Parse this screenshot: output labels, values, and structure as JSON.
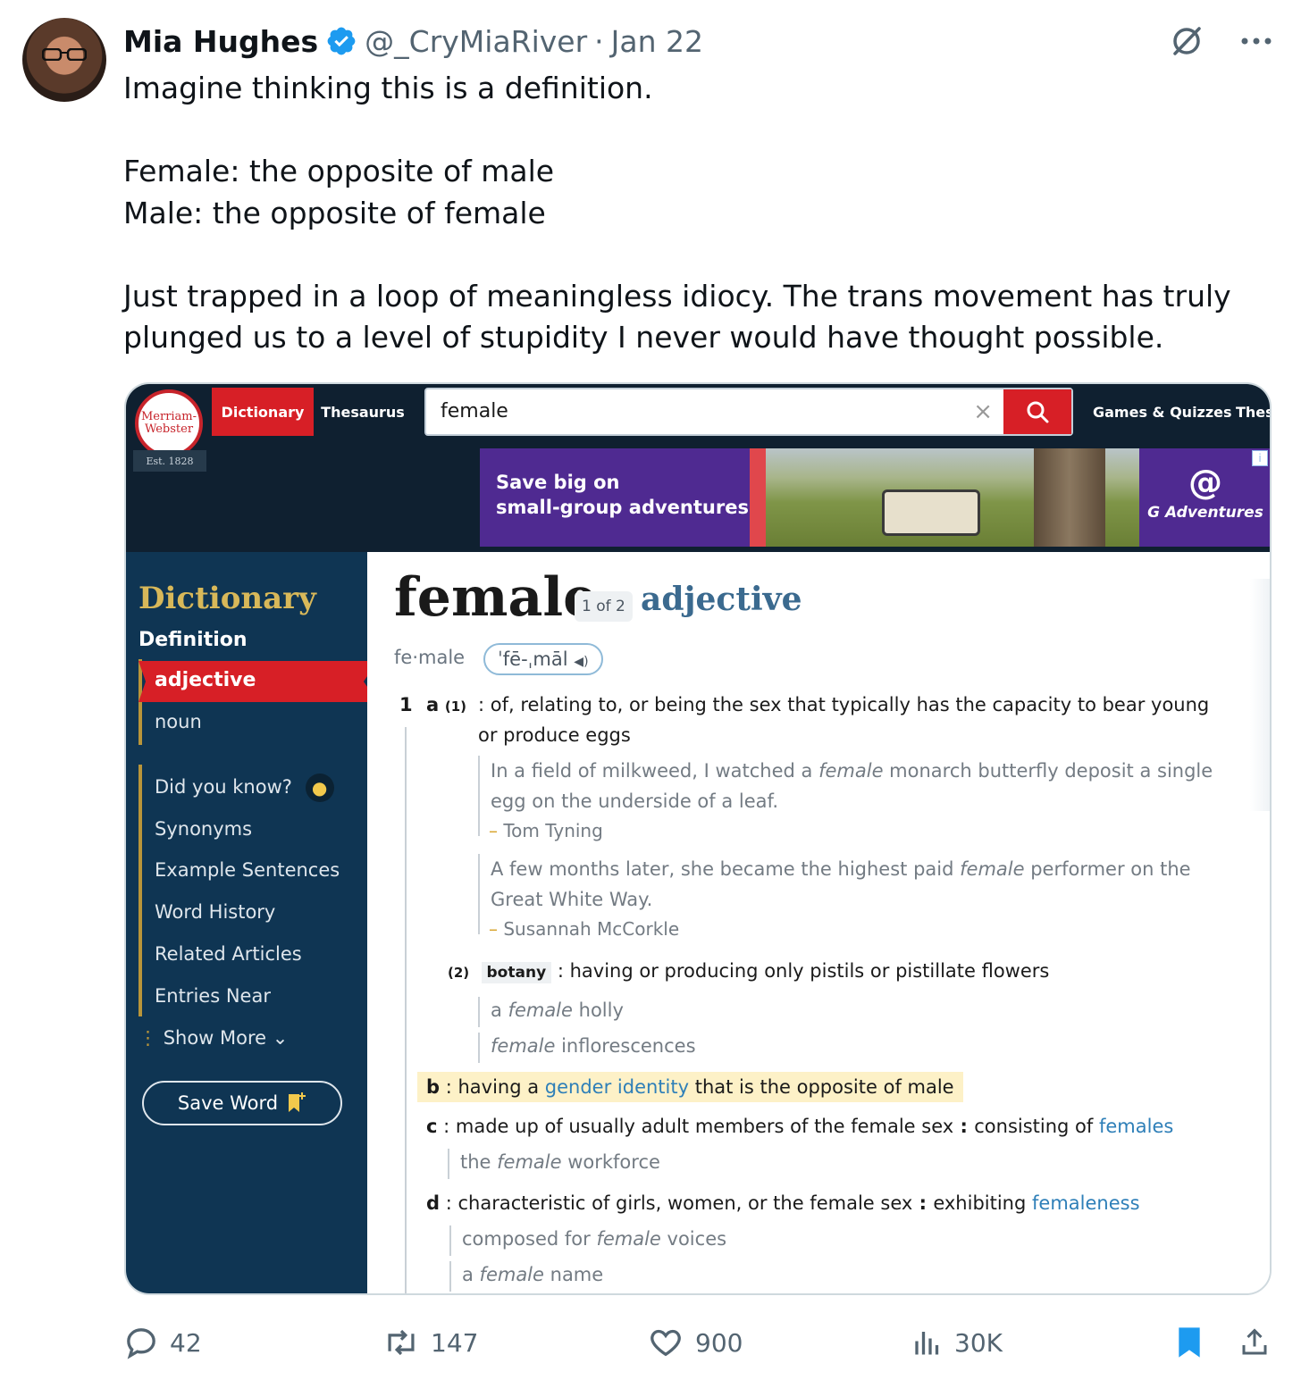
{
  "tweet": {
    "display_name": "Mia Hughes",
    "handle": "@_CryMiaRiver",
    "separator": "·",
    "date": "Jan 22",
    "text": [
      "Imagine thinking this is a definition.",
      "",
      "Female: the opposite of male",
      "Male: the opposite of female",
      "",
      "Just trapped in a loop of meaningless idiocy. The trans movement has truly plunged us to a level of stupidity I never would have thought possible."
    ]
  },
  "site": {
    "logo_line1": "Merriam-",
    "logo_line2": "Webster",
    "est": "Est. 1828",
    "nav_dictionary": "Dictionary",
    "nav_thesaurus": "Thesaurus",
    "search_value": "female",
    "search_clear": "×",
    "nav_games": "Games & Quizzes",
    "nav_thes_cut": "Thes"
  },
  "ad": {
    "line1": "Save big on",
    "line2": "small-group adventures!",
    "brand": "G Adventures",
    "info": "i"
  },
  "sidebar": {
    "title": "Dictionary",
    "subtitle": "Definition",
    "active": "adjective",
    "items": [
      "noun",
      "Did you know?",
      "Synonyms",
      "Example Sentences",
      "Word History",
      "Related Articles",
      "Entries Near",
      "Show More"
    ],
    "save": "Save Word"
  },
  "entry": {
    "headword": "female",
    "count": "1 of 2",
    "pos": "adjective",
    "syllables": "fe·male",
    "pron": "ˈfē-ˌmāl",
    "sense1_num": "1",
    "a": "a",
    "a1": "(1)",
    "a1_text_l1": ": of, relating to, or being the sex that typically has the capacity to bear young",
    "a1_text_l2": "or produce eggs",
    "ex1_pre": "In a field of milkweed, I watched a ",
    "ex1_it": "female",
    "ex1_post": " monarch butterfly deposit a single",
    "ex1_l2": "egg on the underside of a leaf.",
    "ex1_author": "Tom Tyning",
    "ex2_pre": "A few months later, she became the highest paid ",
    "ex2_it": "female",
    "ex2_post": " performer on the",
    "ex2_l2": "Great White Way.",
    "ex2_author": "Susannah McCorkle",
    "a2": "(2)",
    "botany": "botany",
    "a2_text": ": having or producing only pistils or pistillate flowers",
    "ex3_pre": "a ",
    "ex3_it": "female",
    "ex3_post": " holly",
    "ex4_it": "female",
    "ex4_post": " inflorescences",
    "b": "b",
    "b_pre": ": having a ",
    "b_link": "gender identity",
    "b_post": " that is the opposite of male",
    "c": "c",
    "c_text": ": made up of usually adult members of the female sex",
    "c_sep": " : ",
    "c_text2": "consisting of ",
    "c_link": "females",
    "ex5_pre": "the ",
    "ex5_it": "female",
    "ex5_post": " workforce",
    "d": "d",
    "d_text": ": characteristic of girls, women, or the female sex",
    "d_sep": " : ",
    "d_text2": "exhibiting ",
    "d_link": "femaleness",
    "ex6_pre": "composed for ",
    "ex6_it": "female",
    "ex6_post": " voices",
    "ex7_pre": "a ",
    "ex7_it": "female",
    "ex7_post": " name"
  },
  "actions": {
    "replies": "42",
    "reposts": "147",
    "likes": "900",
    "views": "30K"
  },
  "colors": {
    "mw_red": "#d71f26",
    "mw_navy": "#0f3553",
    "mw_gold": "#d8b859",
    "twitter_blue": "#1d9bf0"
  }
}
